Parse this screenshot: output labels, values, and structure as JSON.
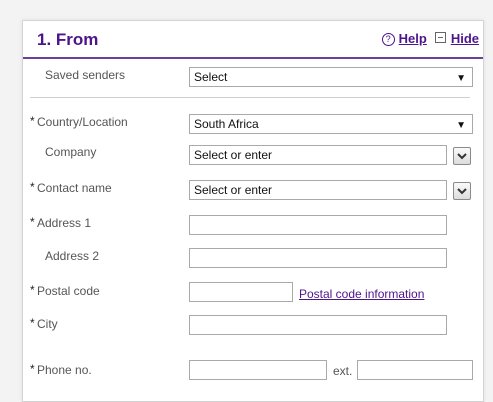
{
  "section": {
    "title": "1. From",
    "help_label": "Help",
    "hide_label": "Hide"
  },
  "fields": {
    "saved_senders": {
      "label": "Saved senders",
      "value": "Select"
    },
    "country": {
      "label": "Country/Location",
      "value": "South Africa",
      "required": "*"
    },
    "company": {
      "label": "Company",
      "placeholder": "Select or enter"
    },
    "contact_name": {
      "label": "Contact name",
      "placeholder": "Select or enter",
      "required": "*"
    },
    "address1": {
      "label": "Address 1",
      "value": "",
      "required": "*"
    },
    "address2": {
      "label": "Address 2",
      "value": ""
    },
    "postal_code": {
      "label": "Postal code",
      "value": "",
      "required": "*",
      "link": "Postal code information"
    },
    "city": {
      "label": "City",
      "value": "",
      "required": "*"
    },
    "phone": {
      "label": "Phone no.",
      "value": "",
      "required": "*",
      "ext_label": "ext.",
      "ext_value": ""
    }
  },
  "colors": {
    "brand_purple": "#4d148c",
    "header_rule": "#6c3f99"
  }
}
